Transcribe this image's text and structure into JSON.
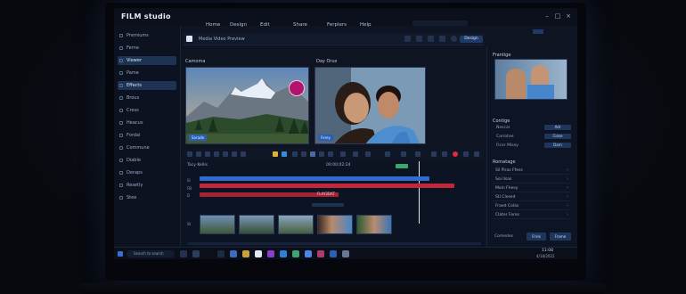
{
  "app": {
    "title": "FILM studio"
  },
  "menu": [
    "Home",
    "Design",
    "Edit",
    "Share",
    "Ferplers",
    "Help"
  ],
  "toolbar": {
    "project_name": "Media Video Preview",
    "pill": "Design"
  },
  "sidebar": {
    "items": [
      {
        "label": "Premiums"
      },
      {
        "label": "Ferne"
      },
      {
        "label": "Viewer",
        "active": true
      },
      {
        "label": "Pame"
      },
      {
        "label": "Effects",
        "active": true
      },
      {
        "label": "Brous"
      },
      {
        "label": "Cress"
      },
      {
        "label": "Heacus"
      },
      {
        "label": "Fordal"
      },
      {
        "label": "Commune"
      },
      {
        "label": "Diable"
      },
      {
        "label": "Deraps"
      },
      {
        "label": "Resetly"
      },
      {
        "label": "Stee"
      }
    ]
  },
  "previews": {
    "left": {
      "label": "Camoma",
      "badge": "Sorade"
    },
    "right": {
      "label": "Day Orus",
      "badge": "Forey"
    }
  },
  "timeline": {
    "label": "Tacy Kellis",
    "time": "00:00:02:24",
    "track_labels": [
      "Sl",
      "FB",
      "D",
      "St"
    ],
    "overlay_label": "FLAY2DAT"
  },
  "right_panel": {
    "thumb_label": "Frantige",
    "section1": "Contige",
    "rows": [
      {
        "label": "Nescal",
        "button": "Adr"
      },
      {
        "label": "Carrotee",
        "button": "Ciose"
      },
      {
        "label": "Ficer Misey",
        "button": "Darn"
      }
    ],
    "section2": "Romatage",
    "list": [
      "Sil Piras Ffess",
      "Soi Ilsas",
      "Moin Fhesy",
      "Sti Clesed",
      "Fraed Colas",
      "Clater Fores"
    ],
    "footer": {
      "label": "Comedes",
      "btn1": "Frink",
      "btn2": "Frame"
    }
  },
  "taskbar": {
    "search_placeholder": "Search to search",
    "clock_time": "11:08",
    "clock_date": "4/18/2022"
  },
  "colors": {
    "accent_blue": "#2a5fb6",
    "track_red": "#c2273a",
    "track_blue": "#2f6bd1",
    "record_red": "#e02b3b"
  }
}
